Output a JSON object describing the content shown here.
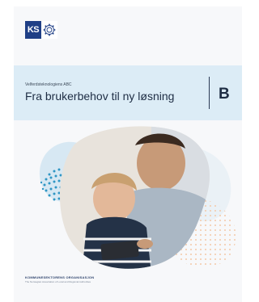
{
  "header": {
    "logo_text": "KS",
    "logo_seal_icon": "ks-seal-icon"
  },
  "band": {
    "eyebrow": "Velferdsteknologiens ABC",
    "title": "Fra brukerbehov til ny løsning",
    "section_letter": "B"
  },
  "cover_image": {
    "description_icon": "parent-and-child-with-tablet-photo"
  },
  "footer": {
    "org_name": "KOMMUNESEKTORENS ORGANISASJON",
    "org_sub": "The Norwegian Association of Local and Regional Authorities"
  },
  "colors": {
    "band": "#dcecf6",
    "logo_blue": "#1f3f86",
    "dot_teal": "#2f96c4",
    "dot_peach": "#f3c9a8"
  }
}
